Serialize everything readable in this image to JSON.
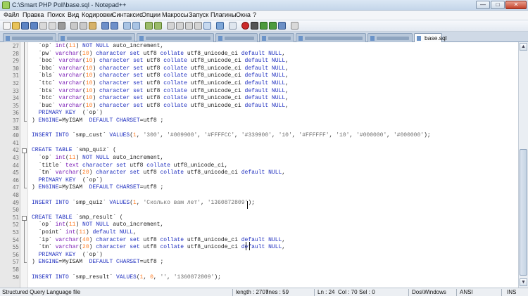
{
  "window": {
    "title": "C:\\Smart PHP Poll\\base.sql - Notepad++",
    "controls": {
      "minimize": "—",
      "maximize": "□",
      "close": "✕"
    }
  },
  "menu": [
    "Файл",
    "Правка",
    "Поиск",
    "Вид",
    "Кодировки",
    "Синтаксис",
    "Опции",
    "Макросы",
    "Запуск",
    "Плагины",
    "Окна",
    "?"
  ],
  "tabs": {
    "active_label": "base.sql"
  },
  "editor": {
    "lines": [
      {
        "n": "27",
        "t": [
          [
            "  `op` ",
            ""
          ],
          [
            "int",
            "tp"
          ],
          [
            "(",
            ""
          ],
          [
            "11",
            "nm"
          ],
          [
            ") ",
            ""
          ],
          [
            "NOT NULL",
            "kw"
          ],
          [
            " auto_increment,",
            ""
          ]
        ]
      },
      {
        "n": "28",
        "t": [
          [
            "  `pw` ",
            ""
          ],
          [
            "varchar",
            "tp"
          ],
          [
            "(",
            ""
          ],
          [
            "10",
            "nm"
          ],
          [
            ") ",
            ""
          ],
          [
            "character set",
            "kw"
          ],
          [
            " utf8 ",
            ""
          ],
          [
            "collate",
            "kw"
          ],
          [
            " utf8_unicode_ci ",
            ""
          ],
          [
            "default NULL",
            "kw"
          ],
          [
            ",",
            ""
          ]
        ]
      },
      {
        "n": "29",
        "t": [
          [
            "  `boc` ",
            ""
          ],
          [
            "varchar",
            "tp"
          ],
          [
            "(",
            ""
          ],
          [
            "10",
            "nm"
          ],
          [
            ") ",
            ""
          ],
          [
            "character set",
            "kw"
          ],
          [
            " utf8 ",
            ""
          ],
          [
            "collate",
            "kw"
          ],
          [
            " utf8_unicode_ci ",
            ""
          ],
          [
            "default NULL",
            "kw"
          ],
          [
            ",",
            ""
          ]
        ]
      },
      {
        "n": "30",
        "t": [
          [
            "  `bbc` ",
            ""
          ],
          [
            "varchar",
            "tp"
          ],
          [
            "(",
            ""
          ],
          [
            "10",
            "nm"
          ],
          [
            ") ",
            ""
          ],
          [
            "character set",
            "kw"
          ],
          [
            " utf8 ",
            ""
          ],
          [
            "collate",
            "kw"
          ],
          [
            " utf8_unicode_ci ",
            ""
          ],
          [
            "default NULL",
            "kw"
          ],
          [
            ",",
            ""
          ]
        ]
      },
      {
        "n": "31",
        "t": [
          [
            "  `bls` ",
            ""
          ],
          [
            "varchar",
            "tp"
          ],
          [
            "(",
            ""
          ],
          [
            "10",
            "nm"
          ],
          [
            ") ",
            ""
          ],
          [
            "character set",
            "kw"
          ],
          [
            " utf8 ",
            ""
          ],
          [
            "collate",
            "kw"
          ],
          [
            " utf8_unicode_ci ",
            ""
          ],
          [
            "default NULL",
            "kw"
          ],
          [
            ",",
            ""
          ]
        ]
      },
      {
        "n": "32",
        "t": [
          [
            "  `ttc` ",
            ""
          ],
          [
            "varchar",
            "tp"
          ],
          [
            "(",
            ""
          ],
          [
            "10",
            "nm"
          ],
          [
            ") ",
            ""
          ],
          [
            "character set",
            "kw"
          ],
          [
            " utf8 ",
            ""
          ],
          [
            "collate",
            "kw"
          ],
          [
            " utf8_unicode_ci ",
            ""
          ],
          [
            "default NULL",
            "kw"
          ],
          [
            ",",
            ""
          ]
        ]
      },
      {
        "n": "33",
        "t": [
          [
            "  `bts` ",
            ""
          ],
          [
            "varchar",
            "tp"
          ],
          [
            "(",
            ""
          ],
          [
            "10",
            "nm"
          ],
          [
            ") ",
            ""
          ],
          [
            "character set",
            "kw"
          ],
          [
            " utf8 ",
            ""
          ],
          [
            "collate",
            "kw"
          ],
          [
            " utf8_unicode_ci ",
            ""
          ],
          [
            "default NULL",
            "kw"
          ],
          [
            ",",
            ""
          ]
        ]
      },
      {
        "n": "34",
        "t": [
          [
            "  `btc` ",
            ""
          ],
          [
            "varchar",
            "tp"
          ],
          [
            "(",
            ""
          ],
          [
            "10",
            "nm"
          ],
          [
            ") ",
            ""
          ],
          [
            "character set",
            "kw"
          ],
          [
            " utf8 ",
            ""
          ],
          [
            "collate",
            "kw"
          ],
          [
            " utf8_unicode_ci ",
            ""
          ],
          [
            "default NULL",
            "kw"
          ],
          [
            ",",
            ""
          ]
        ]
      },
      {
        "n": "35",
        "t": [
          [
            "  `buc` ",
            ""
          ],
          [
            "varchar",
            "tp"
          ],
          [
            "(",
            ""
          ],
          [
            "10",
            "nm"
          ],
          [
            ") ",
            ""
          ],
          [
            "character set",
            "kw"
          ],
          [
            " utf8 ",
            ""
          ],
          [
            "collate",
            "kw"
          ],
          [
            " utf8_unicode_ci ",
            ""
          ],
          [
            "default NULL",
            "kw"
          ],
          [
            ",",
            ""
          ]
        ]
      },
      {
        "n": "36",
        "t": [
          [
            "  ",
            ""
          ],
          [
            "PRIMARY KEY",
            "kw"
          ],
          [
            "  (`op`)",
            ""
          ]
        ]
      },
      {
        "n": "37",
        "t": [
          [
            ") ",
            ""
          ],
          [
            "ENGINE",
            "kw"
          ],
          [
            "=MyISAM  ",
            ""
          ],
          [
            "DEFAULT CHARSET",
            "kw"
          ],
          [
            "=utf8 ;",
            ""
          ]
        ]
      },
      {
        "n": "38",
        "t": []
      },
      {
        "n": "40",
        "t": [
          [
            "INSERT INTO",
            "kw"
          ],
          [
            " `smp_cust` ",
            ""
          ],
          [
            "VALUES",
            "kw"
          ],
          [
            "(",
            ""
          ],
          [
            "1",
            "nm"
          ],
          [
            ", ",
            ""
          ],
          [
            "'300'",
            "st"
          ],
          [
            ", ",
            ""
          ],
          [
            "'#009900'",
            "st"
          ],
          [
            ", ",
            ""
          ],
          [
            "'#FFFFCC'",
            "st"
          ],
          [
            ", ",
            ""
          ],
          [
            "'#339900'",
            "st"
          ],
          [
            ", ",
            ""
          ],
          [
            "'10'",
            "st"
          ],
          [
            ", ",
            ""
          ],
          [
            "'#FFFFFF'",
            "st"
          ],
          [
            ", ",
            ""
          ],
          [
            "'10'",
            "st"
          ],
          [
            ", ",
            ""
          ],
          [
            "'#000000'",
            "st"
          ],
          [
            ", ",
            ""
          ],
          [
            "'#000000'",
            "st"
          ],
          [
            ");",
            ""
          ]
        ]
      },
      {
        "n": "41",
        "t": []
      },
      {
        "n": "42",
        "t": [
          [
            "CREATE TABLE",
            "kw"
          ],
          [
            " `smp_quiz` (",
            ""
          ]
        ]
      },
      {
        "n": "43",
        "t": [
          [
            "  `op` ",
            ""
          ],
          [
            "int",
            "tp"
          ],
          [
            "(",
            ""
          ],
          [
            "11",
            "nm"
          ],
          [
            ") ",
            ""
          ],
          [
            "NOT NULL",
            "kw"
          ],
          [
            " auto_increment,",
            ""
          ]
        ]
      },
      {
        "n": "44",
        "t": [
          [
            "  `title` ",
            ""
          ],
          [
            "text",
            "tp"
          ],
          [
            " ",
            ""
          ],
          [
            "character set",
            "kw"
          ],
          [
            " utf8 ",
            ""
          ],
          [
            "collate",
            "kw"
          ],
          [
            " utf8_unicode_ci,",
            ""
          ]
        ]
      },
      {
        "n": "45",
        "t": [
          [
            "  `tm` ",
            ""
          ],
          [
            "varchar",
            "tp"
          ],
          [
            "(",
            ""
          ],
          [
            "20",
            "nm"
          ],
          [
            ") ",
            ""
          ],
          [
            "character set",
            "kw"
          ],
          [
            " utf8 ",
            ""
          ],
          [
            "collate",
            "kw"
          ],
          [
            " utf8_unicode_ci ",
            ""
          ],
          [
            "default NULL",
            "kw"
          ],
          [
            ",",
            ""
          ]
        ]
      },
      {
        "n": "46",
        "t": [
          [
            "  ",
            ""
          ],
          [
            "PRIMARY KEY",
            "kw"
          ],
          [
            "  (`op`)",
            ""
          ]
        ]
      },
      {
        "n": "47",
        "t": [
          [
            ") ",
            ""
          ],
          [
            "ENGINE",
            "kw"
          ],
          [
            "=MyISAM  ",
            ""
          ],
          [
            "DEFAULT CHARSET",
            "kw"
          ],
          [
            "=utf8 ;",
            ""
          ]
        ]
      },
      {
        "n": "48",
        "t": []
      },
      {
        "n": "49",
        "t": [
          [
            "INSERT INTO",
            "kw"
          ],
          [
            " `smp_quiz` ",
            ""
          ],
          [
            "VALUES",
            "kw"
          ],
          [
            "(",
            ""
          ],
          [
            "1",
            "nm"
          ],
          [
            ", ",
            ""
          ],
          [
            "'Сколько вам лет'",
            "st"
          ],
          [
            ", ",
            ""
          ],
          [
            "'1360872809'",
            "st"
          ],
          [
            ");",
            ""
          ]
        ]
      },
      {
        "n": "50",
        "t": []
      },
      {
        "n": "51",
        "t": [
          [
            "CREATE TABLE",
            "kw"
          ],
          [
            " `smp_result` (",
            ""
          ]
        ]
      },
      {
        "n": "52",
        "t": [
          [
            "  `op` ",
            ""
          ],
          [
            "int",
            "tp"
          ],
          [
            "(",
            ""
          ],
          [
            "11",
            "nm"
          ],
          [
            ") ",
            ""
          ],
          [
            "NOT NULL",
            "kw"
          ],
          [
            " auto_increment,",
            ""
          ]
        ]
      },
      {
        "n": "53",
        "t": [
          [
            "  `point` ",
            ""
          ],
          [
            "int",
            "tp"
          ],
          [
            "(",
            ""
          ],
          [
            "11",
            "nm"
          ],
          [
            ") ",
            ""
          ],
          [
            "default NULL",
            "kw"
          ],
          [
            ",",
            ""
          ]
        ]
      },
      {
        "n": "54",
        "t": [
          [
            "  `ip` ",
            ""
          ],
          [
            "varchar",
            "tp"
          ],
          [
            "(",
            ""
          ],
          [
            "40",
            "nm"
          ],
          [
            ") ",
            ""
          ],
          [
            "character set",
            "kw"
          ],
          [
            " utf8 ",
            ""
          ],
          [
            "collate",
            "kw"
          ],
          [
            " utf8_unicode_ci ",
            ""
          ],
          [
            "default NULL",
            "kw"
          ],
          [
            ",",
            ""
          ]
        ]
      },
      {
        "n": "55",
        "t": [
          [
            "  `tm` ",
            ""
          ],
          [
            "varchar",
            "tp"
          ],
          [
            "(",
            ""
          ],
          [
            "20",
            "nm"
          ],
          [
            ") ",
            ""
          ],
          [
            "character set",
            "kw"
          ],
          [
            " utf8 ",
            ""
          ],
          [
            "collate",
            "kw"
          ],
          [
            " utf8_unicode_ci ",
            ""
          ],
          [
            "default NULL",
            "kw"
          ],
          [
            ",",
            ""
          ]
        ]
      },
      {
        "n": "56",
        "t": [
          [
            "  ",
            ""
          ],
          [
            "PRIMARY KEY",
            "kw"
          ],
          [
            "  (`op`)",
            ""
          ]
        ]
      },
      {
        "n": "57",
        "t": [
          [
            ") ",
            ""
          ],
          [
            "ENGINE",
            "kw"
          ],
          [
            "=MyISAM  ",
            ""
          ],
          [
            "DEFAULT CHARSET",
            "kw"
          ],
          [
            "=utf8 ;",
            ""
          ]
        ]
      },
      {
        "n": "58",
        "t": []
      },
      {
        "n": "59",
        "t": [
          [
            "INSERT INTO",
            "kw"
          ],
          [
            " `smp_result` ",
            ""
          ],
          [
            "VALUES",
            "kw"
          ],
          [
            "(",
            ""
          ],
          [
            "1",
            "nm"
          ],
          [
            ", ",
            ""
          ],
          [
            "0",
            "nm"
          ],
          [
            ", ",
            ""
          ],
          [
            "''",
            "st"
          ],
          [
            ", ",
            ""
          ],
          [
            "'1360872809'",
            "st"
          ],
          [
            ");",
            ""
          ]
        ]
      }
    ]
  },
  "status": {
    "language": "Structured Query Language file",
    "length": "length : 2707",
    "lines": "lines : 59",
    "ln": "Ln : 24",
    "col": "Col : 70",
    "sel": "Sel : 0",
    "eol": "Dos\\Windows",
    "encoding": "ANSI",
    "mode": "INS"
  },
  "colors": {
    "keyword": "#1f2fbf",
    "type": "#7a1cb5",
    "number": "#ff7f27",
    "string": "#6e6e6e"
  }
}
